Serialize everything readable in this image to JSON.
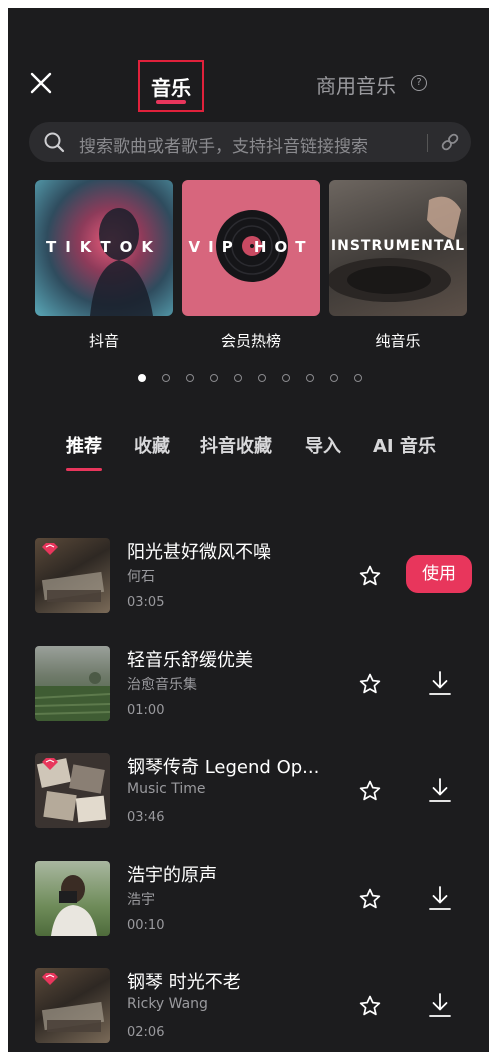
{
  "header": {
    "tab_music": "音乐",
    "tab_commercial": "商用音乐",
    "help_mark": "?"
  },
  "search": {
    "placeholder": "搜索歌曲或者歌手，支持抖音链接搜索"
  },
  "categories": [
    {
      "overlay": "TIKTOK",
      "label": "抖音"
    },
    {
      "overlay": "VIP HOT",
      "label": "会员热榜"
    },
    {
      "overlay": "INSTRUMENTAL",
      "label": "纯音乐"
    }
  ],
  "carousel": {
    "page_count": 10,
    "active_index": 0
  },
  "subtabs": [
    {
      "label": "推荐",
      "active": true
    },
    {
      "label": "收藏",
      "active": false
    },
    {
      "label": "抖音收藏",
      "active": false
    },
    {
      "label": "导入",
      "active": false
    },
    {
      "label": "AI 音乐",
      "active": false
    }
  ],
  "songs": [
    {
      "title": "阳光甚好微风不噪",
      "artist": "何石",
      "duration": "03:05",
      "vip": true,
      "action": "使用"
    },
    {
      "title": "轻音乐舒缓优美",
      "artist": "治愈音乐集",
      "duration": "01:00",
      "vip": false,
      "action": "download"
    },
    {
      "title": "钢琴传奇 Legend Op...",
      "artist": "Music Time",
      "duration": "03:46",
      "vip": true,
      "action": "download"
    },
    {
      "title": "浩宇的原声",
      "artist": "浩宇",
      "duration": "00:10",
      "vip": false,
      "action": "download"
    },
    {
      "title": "钢琴 时光不老",
      "artist": "Ricky Wang",
      "duration": "02:06",
      "vip": true,
      "action": "download"
    }
  ],
  "colors": {
    "accent": "#e8365c",
    "background": "#1c1c1e"
  }
}
